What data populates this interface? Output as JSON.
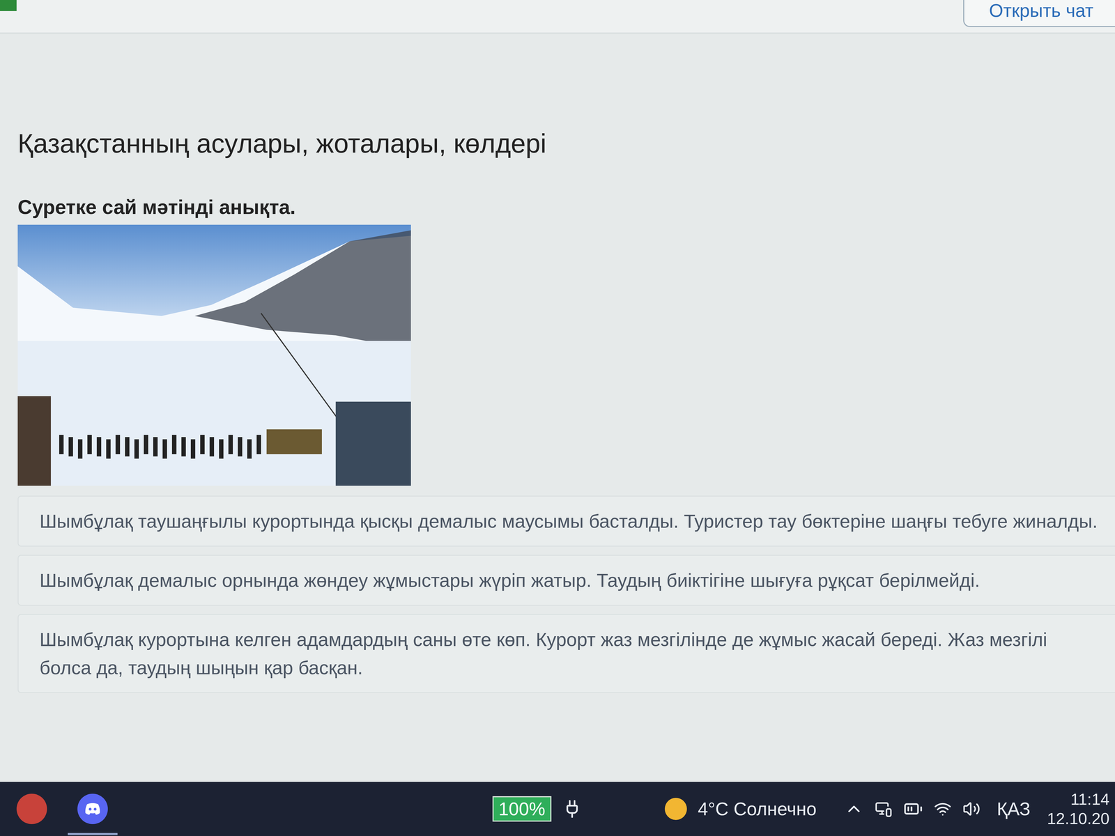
{
  "header": {
    "chat_button": "Открыть чат"
  },
  "page": {
    "title": "Қазақстанның асулары, жоталары, көлдері",
    "question": "Суретке сай мәтінді анықта."
  },
  "options": [
    {
      "text": "Шымбұлақ таушаңғылы курортында қысқы демалыс маусымы басталды. Туристер тау бөктеріне шаңғы тебуге жиналды.",
      "selected": false
    },
    {
      "text": "Шымбұлақ демалыс орнында жөндеу жұмыстары жүріп жатыр. Таудың биіктігіне шығуға рұқсат берілмейді.",
      "selected": false
    },
    {
      "text": "Шымбұлақ курортына келген адамдардың саны өте көп. Курорт жаз мезгілінде де жұмыс жасай береді. Жаз мезгілі болса да, таудың шыңын қар басқан.",
      "selected": false
    }
  ],
  "taskbar": {
    "battery": "100%",
    "weather": "4°C Солнечно",
    "language": "ҚАЗ",
    "time": "11:14",
    "date": "12.10.20"
  }
}
